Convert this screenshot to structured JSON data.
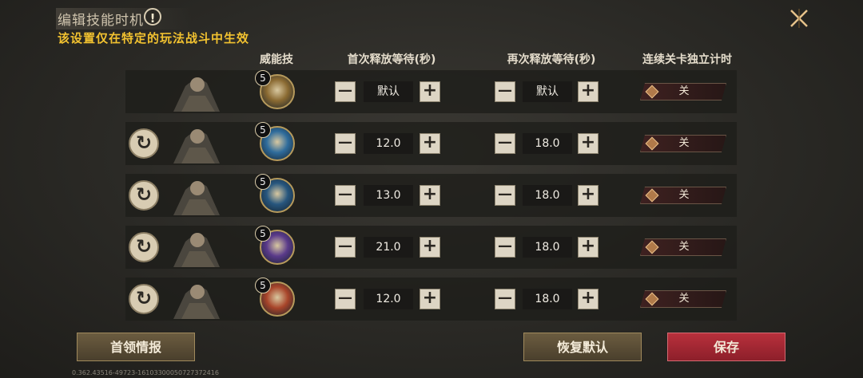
{
  "header": {
    "title": "编辑技能时机",
    "warning_icon": "!",
    "subtitle": "该设置仅在特定的玩法战斗中生效"
  },
  "columns": {
    "ultimate": "威能技",
    "first_wait": "首次释放等待(秒)",
    "repeat_wait": "再次释放等待(秒)",
    "independent_timer": "连续关卡独立计时"
  },
  "rows": [
    {
      "has_reset": false,
      "portrait": "hero-crowned-armored",
      "skill_icon": "golden-figure-skill-icon",
      "skill_color": "#8a6a32",
      "level": "5",
      "first_wait": "默认",
      "repeat_wait": "默认",
      "toggle": "关"
    },
    {
      "has_reset": true,
      "portrait": "hero-winged-woman",
      "skill_icon": "lightning-skill-icon",
      "skill_color": "#2f6c9c",
      "level": "5",
      "first_wait": "12.0",
      "repeat_wait": "18.0",
      "toggle": "关"
    },
    {
      "has_reset": true,
      "portrait": "hero-bearded-warrior",
      "skill_icon": "trident-skill-icon",
      "skill_color": "#27567e",
      "level": "5",
      "first_wait": "13.0",
      "repeat_wait": "18.0",
      "toggle": "关"
    },
    {
      "has_reset": true,
      "portrait": "hero-horned-beast",
      "skill_icon": "purple-spirit-skill-icon",
      "skill_color": "#5a3a8a",
      "level": "5",
      "first_wait": "21.0",
      "repeat_wait": "18.0",
      "toggle": "关"
    },
    {
      "has_reset": true,
      "portrait": "hero-elf-archer",
      "skill_icon": "fire-phoenix-skill-icon",
      "skill_color": "#a8452a",
      "level": "5",
      "first_wait": "12.0",
      "repeat_wait": "18.0",
      "toggle": "关"
    }
  ],
  "buttons": {
    "boss_info": "首领情报",
    "restore_default": "恢复默认",
    "save": "保存"
  },
  "version": "0.362.43516-49723-16103300050727372416"
}
